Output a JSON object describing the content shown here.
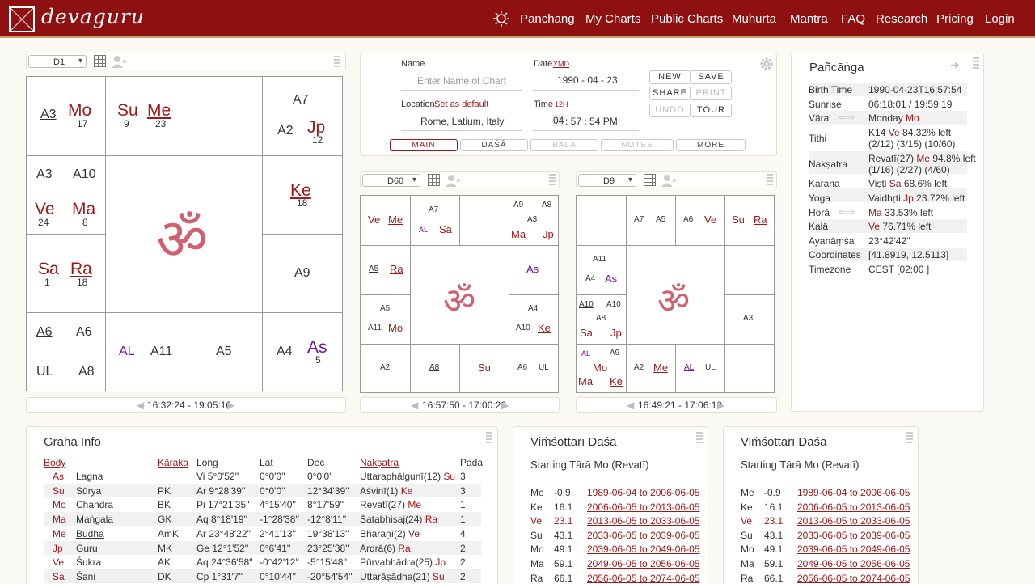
{
  "header": {
    "logo": "devaguru",
    "nav": [
      "Panchang",
      "My Charts",
      "Public Charts",
      "Muhurta",
      "Mantra",
      "FAQ",
      "Research",
      "Pricing",
      "Login"
    ]
  },
  "d1": {
    "select": "D1",
    "time_range": "16:32:24 - 19:05:16",
    "cells": {
      "c1": [
        {
          "t": "A3",
          "cls": "u"
        },
        {
          "t": "Mo",
          "cls": "pl"
        },
        {
          "t": "17"
        }
      ],
      "c2": [
        {
          "t": "Su"
        },
        {
          "t": "9"
        },
        {
          "t": "Me"
        },
        {
          "t": "23"
        }
      ],
      "c4": [
        {
          "t": "A7"
        },
        {
          "t": "A2"
        },
        {
          "t": "Jp"
        },
        {
          "t": "12"
        }
      ],
      "c5": [
        {
          "t": "A3"
        },
        {
          "t": "A10"
        },
        {
          "t": "Ve"
        },
        {
          "t": "24"
        },
        {
          "t": "Ma"
        },
        {
          "t": "8"
        }
      ],
      "c8": [
        {
          "t": "Ke"
        },
        {
          "t": "18"
        }
      ],
      "c9": [
        {
          "t": "Sa"
        },
        {
          "t": "1"
        },
        {
          "t": "Ra"
        },
        {
          "t": "18"
        }
      ],
      "c12": [
        {
          "t": "A9"
        }
      ],
      "c13": [
        {
          "t": "A6"
        },
        {
          "t": "A6"
        },
        {
          "t": "UL"
        },
        {
          "t": "A8"
        }
      ],
      "c14": [
        {
          "t": "AL"
        },
        {
          "t": "A11"
        }
      ],
      "c15": [
        {
          "t": "A5"
        }
      ],
      "c16": [
        {
          "t": "A4"
        },
        {
          "t": "As"
        },
        {
          "t": "5"
        }
      ]
    }
  },
  "form": {
    "name_label": "Name",
    "name_placeholder": "Enter Name of Chart",
    "date_label": "Date",
    "date_fmt": "YMD",
    "date_value": "1990  -  04  -  23",
    "location_label": "Location",
    "location_link": "Set as default",
    "location_value": "Rome, Latium, Italy",
    "time_label": "Time",
    "time_fmt": "12H",
    "time_h": "04",
    "time_rest": " : 57 : 54   PM",
    "buttons": [
      "NEW",
      "SAVE",
      "SHARE",
      "PRINT",
      "UNDO",
      "TOUR"
    ],
    "tabs": [
      "MAIN",
      "DAŚĀ",
      "BALA",
      "NOTES",
      "MORE"
    ]
  },
  "d60": {
    "select": "D60",
    "time_range": "16:57:50 - 17:00:22",
    "labels": [
      "Ve",
      "Me",
      "A7",
      "AL",
      "Sa",
      "A9",
      "A8",
      "A3",
      "Ma",
      "Jp",
      "A5",
      "Ra",
      "As",
      "A5",
      "A11",
      "Mo",
      "A4",
      "A10",
      "Ke",
      "A2",
      "A8",
      "Su",
      "A6",
      "UL"
    ]
  },
  "d9": {
    "select": "D9",
    "time_range": "16:49:21 - 17:06:18",
    "labels": [
      "A7",
      "A5",
      "A6",
      "Ve",
      "Su",
      "Ra",
      "A11",
      "A4",
      "As",
      "A10",
      "A10",
      "A8",
      "Sa",
      "Jp",
      "A3",
      "AL",
      "A9",
      "Mo",
      "Ma",
      "Ke",
      "A2",
      "Me",
      "AL",
      "UL"
    ]
  },
  "pancanga": {
    "title": "Pañcāṅga",
    "rows": [
      {
        "k": "Birth Time",
        "v": "1990-04-23T16:57:54"
      },
      {
        "k": "Sunrise",
        "v": "06:18:01 / 19:59:19"
      },
      {
        "k": "Vāra",
        "v": "Monday ",
        "pl": "Mo"
      },
      {
        "k": "Tithi",
        "v": "K14 ",
        "pl": "Ve",
        "v2": " 84.32% left",
        "v3": "(2/12) (3/15) (10/60)"
      },
      {
        "k": "Nakṣatra",
        "v": "Revatī(27) ",
        "pl": "Me",
        "v2": " 94.8% left",
        "v3": "(1/16) (2/27) (4/60)"
      },
      {
        "k": "Karaṇa",
        "v": "Viṣṭi ",
        "pl": "Sa",
        "v2": " 68.6% left"
      },
      {
        "k": "Yoga",
        "v": "Vaidhṛti ",
        "pl": "Jp",
        "v2": " 23.72% left"
      },
      {
        "k": "Horā",
        "v": "",
        "pl": "Ma",
        "v2": " 33.53% left"
      },
      {
        "k": "Kalā",
        "v": "",
        "pl": "Ve",
        "v2": " 76.71% left"
      },
      {
        "k": "Ayanāṃśa",
        "v": "23°42'42''"
      },
      {
        "k": "Coordinates",
        "v": "[41.8919, 12.5113]"
      },
      {
        "k": "Timezone",
        "v": "CEST [02:00 ]"
      }
    ]
  },
  "graha": {
    "title": "Graha Info",
    "headers": [
      "Body",
      "Kāraka",
      "Long",
      "Lat",
      "Dec",
      "Nakṣatra",
      "Pada"
    ],
    "rows": [
      [
        "As",
        "Lagna",
        "",
        "Vi 5°0'52''",
        "0°0'0''",
        "0°0'0''",
        "Uttaraphālgunī(12) ",
        "Su",
        "3"
      ],
      [
        "Su",
        "Sūrya",
        "PK",
        "Ar 9°28'39''",
        "0°0'0''",
        "12°34'39''",
        "Aśvinī(1) ",
        "Ke",
        "3"
      ],
      [
        "Mo",
        "Chandra",
        "BK",
        "Pi 17°21'35''",
        "4°15'40''",
        "8°17'59''",
        "Revatī(27) ",
        "Me",
        "1"
      ],
      [
        "Ma",
        "Maṅgala",
        "GK",
        "Aq 8°18'19''",
        "-1°28'38''",
        "-12°8'11''",
        "Śatabhiṣaj(24) ",
        "Ra",
        "1"
      ],
      [
        "Me",
        "Budha",
        "AmK",
        "Ar 23°48'22''",
        "2°41'13''",
        "19°38'13''",
        "Bharaṇī(2) ",
        "Ve",
        "4"
      ],
      [
        "Jp",
        "Guru",
        "MK",
        "Ge 12°1'52''",
        "0°6'41''",
        "23°25'38''",
        "Ārdrā(6) ",
        "Ra",
        "2"
      ],
      [
        "Ve",
        "Śukra",
        "AK",
        "Aq 24°36'58''",
        "-0°42'12''",
        "-5°15'48''",
        "Pūrvabhādra(25) ",
        "Jp",
        "2"
      ],
      [
        "Sa",
        "Śani",
        "DK",
        "Cp 1°31'7''",
        "0°10'44''",
        "-20°54'54''",
        "Uttarāṣāḍha(21) ",
        "Su",
        "2"
      ]
    ]
  },
  "dasa": {
    "title": "Viṁśottarī Daśā",
    "starting": "Starting Tārā Mo (Revatī)",
    "rows": [
      [
        "Me",
        "-0.9",
        "1989-06-04 to 2006-06-05"
      ],
      [
        "Ke",
        "16.1",
        "2006-06-05 to 2013-06-05"
      ],
      [
        "Ve",
        "23.1",
        "2013-06-05 to 2033-06-05"
      ],
      [
        "Su",
        "43.1",
        "2033-06-05 to 2039-06-05"
      ],
      [
        "Mo",
        "49.1",
        "2039-06-05 to 2049-06-05"
      ],
      [
        "Ma",
        "59.1",
        "2049-06-05 to 2056-06-05"
      ],
      [
        "Ra",
        "66.1",
        "2056-06-05 to 2074-06-05"
      ]
    ]
  }
}
